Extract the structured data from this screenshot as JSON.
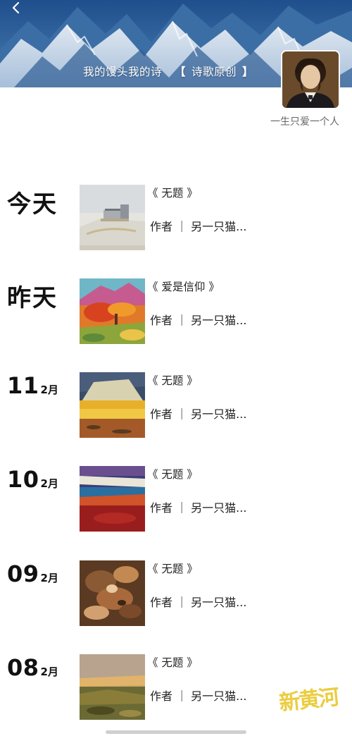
{
  "header": {
    "title": "我的馒头我的诗",
    "bracket_open": "【",
    "subtitle": "诗歌原创",
    "bracket_close": "】",
    "signature": "一生只爱一个人",
    "back_icon": "chevron-left-icon"
  },
  "posts": [
    {
      "date_text": "今天",
      "day": "",
      "month": "",
      "title": "《 无题 》",
      "author": "作者 ｜ 另一只猫..."
    },
    {
      "date_text": "昨天",
      "day": "",
      "month": "",
      "title": "《 爱是信仰 》",
      "author": "作者 ｜ 另一只猫..."
    },
    {
      "date_text": "",
      "day": "11",
      "month": "2月",
      "title": "《 无题 》",
      "author": "作者 ｜ 另一只猫..."
    },
    {
      "date_text": "",
      "day": "10",
      "month": "2月",
      "title": "《 无题 》",
      "author": "作者 ｜ 另一只猫..."
    },
    {
      "date_text": "",
      "day": "09",
      "month": "2月",
      "title": "《 无题 》",
      "author": "作者 ｜ 另一只猫..."
    },
    {
      "date_text": "",
      "day": "08",
      "month": "2月",
      "title": "《 无题 》",
      "author": "作者 ｜ 另一只猫..."
    }
  ],
  "watermark": "新黄河",
  "colors": {
    "cover_sky": "#3f72a8",
    "text": "#222222",
    "secondary_text": "#666666",
    "watermark": "#e8c41e"
  }
}
